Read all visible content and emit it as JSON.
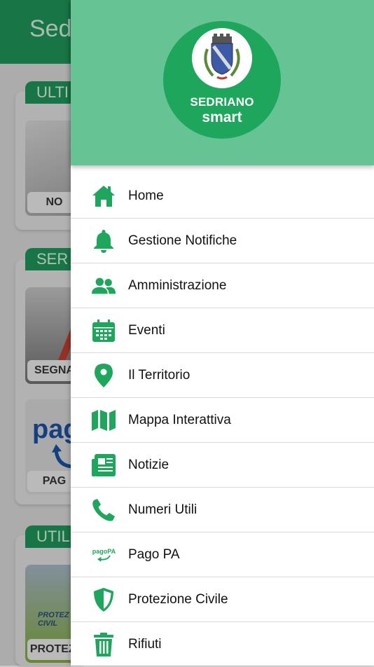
{
  "background": {
    "header_title": "Sed",
    "sections": [
      {
        "pill": "ULTI",
        "tile_label": "NO"
      },
      {
        "pill": "SER",
        "tile_label": "SEGNA"
      },
      {
        "pill": "",
        "tile_label": "PAG"
      },
      {
        "pill": "UTIL",
        "tile_label": "PROTEZI"
      }
    ],
    "tile_texts": {
      "pago": "pag",
      "protezione": "PROTEZ CIVIL"
    }
  },
  "drawer": {
    "logo": {
      "line1": "SEDRIANO",
      "line2": "smart"
    },
    "items": [
      {
        "label": "Home",
        "icon": "home-icon"
      },
      {
        "label": "Gestione Notifiche",
        "icon": "bell-icon"
      },
      {
        "label": "Amministrazione",
        "icon": "users-icon"
      },
      {
        "label": "Eventi",
        "icon": "calendar-icon"
      },
      {
        "label": "Il Territorio",
        "icon": "map-pin-icon"
      },
      {
        "label": "Mappa Interattiva",
        "icon": "map-icon"
      },
      {
        "label": "Notizie",
        "icon": "newspaper-icon"
      },
      {
        "label": "Numeri Utili",
        "icon": "phone-icon"
      },
      {
        "label": "Pago PA",
        "icon": "pagopa-icon"
      },
      {
        "label": "Protezione Civile",
        "icon": "shield-icon"
      },
      {
        "label": "Rifiuti",
        "icon": "trash-icon"
      }
    ]
  },
  "colors": {
    "accent": "#1ea65d",
    "header_green": "#66c393",
    "icon_green": "#1ea65d"
  },
  "pagopa_icon_text": "pagoPA"
}
